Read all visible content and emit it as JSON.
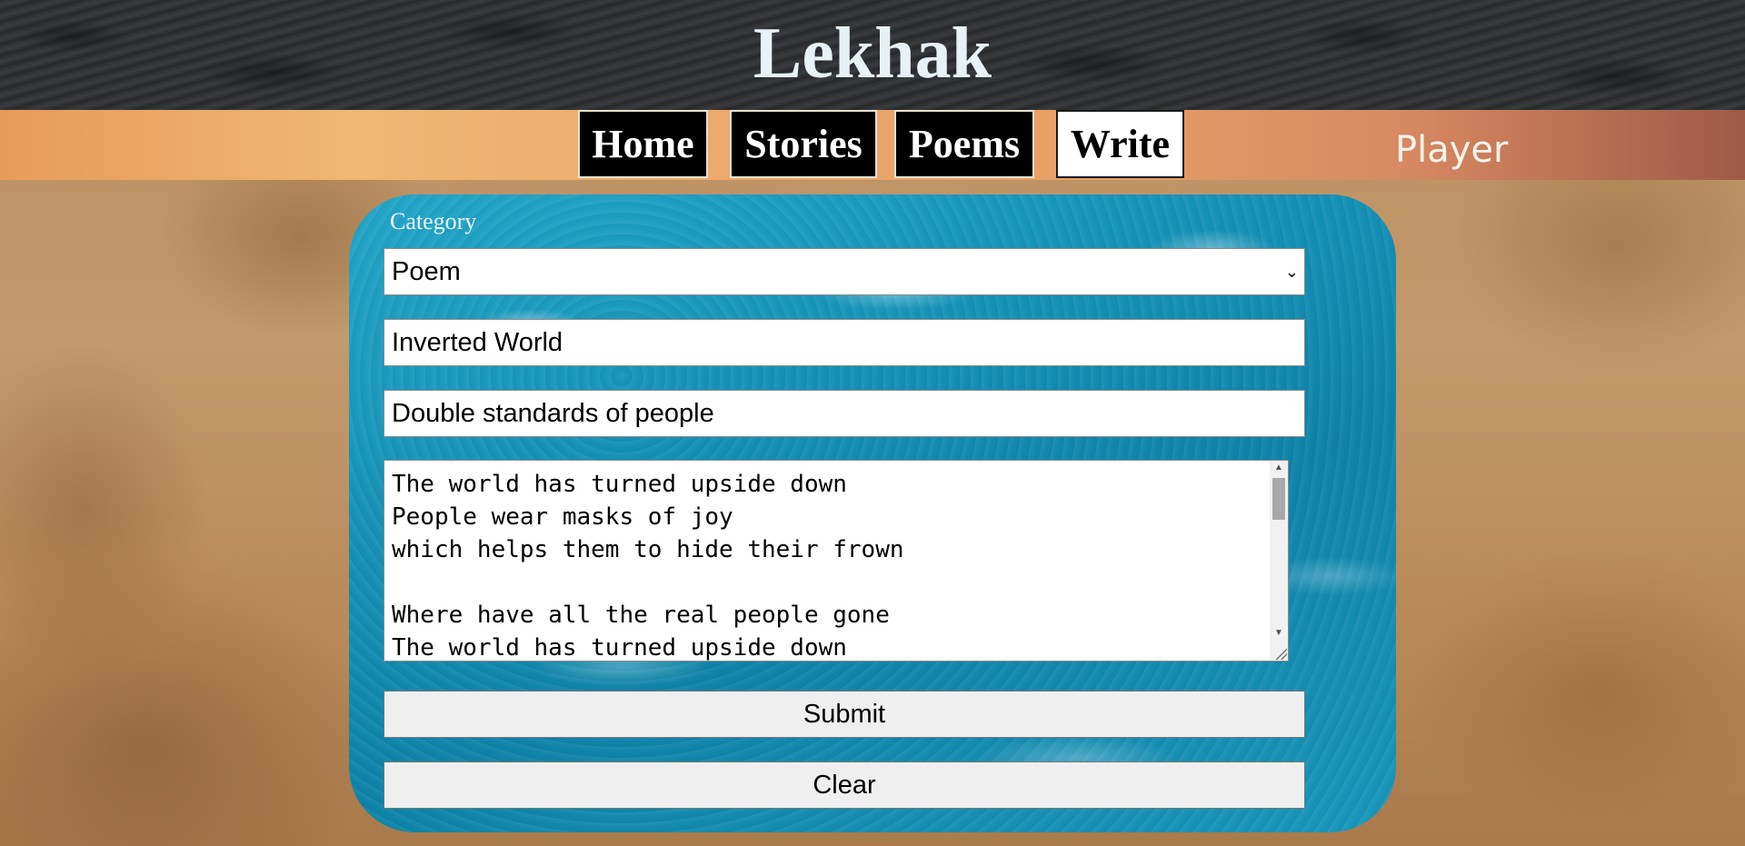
{
  "header": {
    "title": "Lekhak"
  },
  "nav": {
    "items": [
      {
        "label": "Home",
        "active": false
      },
      {
        "label": "Stories",
        "active": false
      },
      {
        "label": "Poems",
        "active": false
      },
      {
        "label": "Write",
        "active": true
      }
    ],
    "player_label": "Player"
  },
  "form": {
    "category_label": "Category",
    "category_value": "Poem",
    "title_value": "Inverted World",
    "description_value": "Double standards of people",
    "body_lines": [
      "The world has turned upside down",
      "People wear masks of joy",
      "which helps them to hide their frown",
      "",
      "Where have all the real people gone",
      "The world has turned upside down"
    ],
    "submit_label": "Submit",
    "clear_label": "Clear"
  },
  "colors": {
    "header_bg": "#2f3133",
    "title_color": "#e8f1f6",
    "nav_active_bg": "#ffffff",
    "nav_inactive_bg": "#000000",
    "panel_accent": "#1591b6"
  },
  "icons": {
    "select_chevron": "chevron-down-icon",
    "scroll_up": "scroll-up-arrow-icon",
    "scroll_down": "scroll-down-arrow-icon",
    "resize": "resize-grip-icon"
  }
}
